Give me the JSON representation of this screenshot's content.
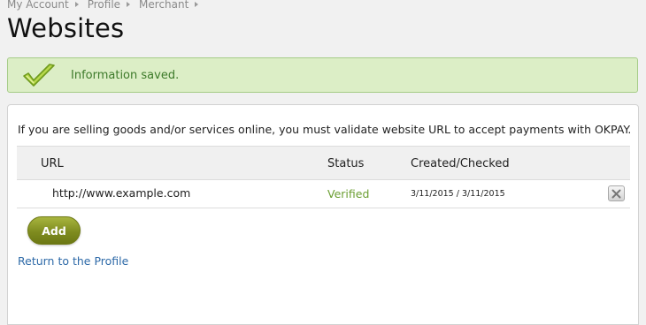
{
  "breadcrumb": [
    {
      "label": "My Account"
    },
    {
      "label": "Profile"
    },
    {
      "label": "Merchant"
    }
  ],
  "page": {
    "title": "Websites"
  },
  "alert": {
    "message": "Information saved.",
    "icon": "checkmark-icon",
    "background": "#dceec6",
    "border": "#a6cc88"
  },
  "panel": {
    "intro": "If you are selling goods and/or services online, you must validate website URL to accept payments with OKPAY.",
    "table": {
      "columns": {
        "url": "URL",
        "status": "Status",
        "created": "Created/Checked"
      },
      "rows": [
        {
          "url": "http://www.example.com",
          "status": "Verified",
          "created_checked": "3/11/2015 / 3/11/2015",
          "delete_icon": "close-icon"
        }
      ]
    },
    "add_label": "Add",
    "return_link": "Return to the Profile"
  },
  "colors": {
    "verified": "#6b9e32",
    "link": "#2e6aa8",
    "add_button": "#7f8c1f"
  }
}
